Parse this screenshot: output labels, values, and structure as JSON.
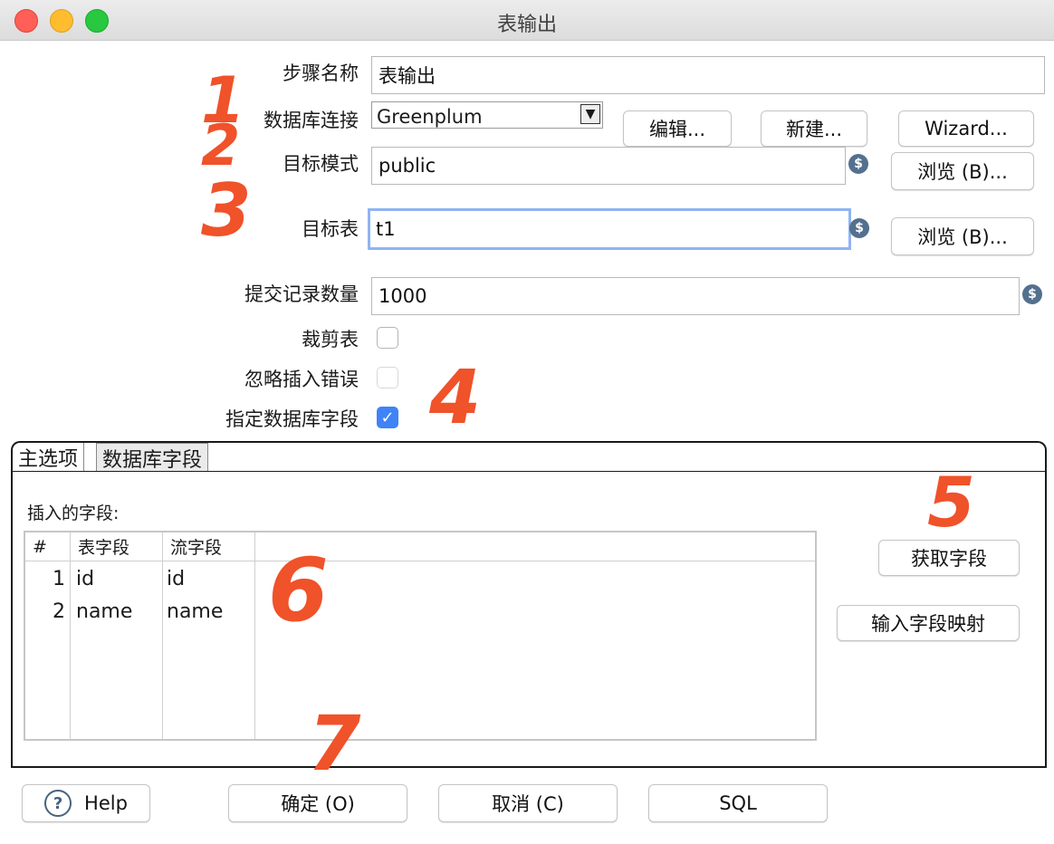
{
  "window": {
    "title": "表输出"
  },
  "form": {
    "step_name": {
      "label": "步骤名称",
      "value": "表输出"
    },
    "db_connection": {
      "label": "数据库连接",
      "value": "Greenplum",
      "edit_label": "编辑...",
      "new_label": "新建...",
      "wizard_label": "Wizard..."
    },
    "target_schema": {
      "label": "目标模式",
      "value": "public",
      "browse_label": "浏览 (B)..."
    },
    "target_table": {
      "label": "目标表",
      "value": "t1",
      "browse_label": "浏览 (B)..."
    },
    "commit_size": {
      "label": "提交记录数量",
      "value": "1000"
    },
    "truncate_table": {
      "label": "裁剪表",
      "checked": false
    },
    "ignore_insert_errors": {
      "label": "忽略插入错误",
      "checked": false
    },
    "specify_db_fields": {
      "label": "指定数据库字段",
      "checked": true,
      "check_glyph": "✓"
    }
  },
  "tabs": [
    {
      "label": "主选项",
      "active": false
    },
    {
      "label": "数据库字段",
      "active": true
    }
  ],
  "fields_tab": {
    "insert_fields_label": "插入的字段:",
    "columns": [
      "#",
      "表字段",
      "流字段"
    ],
    "rows": [
      {
        "num": "1",
        "table_field": "id",
        "stream_field": "id"
      },
      {
        "num": "2",
        "table_field": "name",
        "stream_field": "name"
      }
    ],
    "get_fields_label": "获取字段",
    "input_mapping_label": "输入字段映射"
  },
  "buttons": {
    "help": "Help",
    "ok": "确定 (O)",
    "cancel": "取消 (C)",
    "sql": "SQL"
  },
  "icons": {
    "variable": "$",
    "help": "?",
    "dropdown": "▼"
  },
  "annotations": [
    "1",
    "2",
    "3",
    "4",
    "5",
    "6",
    "7"
  ],
  "colors": {
    "annotation": "#f0522a",
    "checkbox_on": "#3f83f8",
    "focus_ring": "#8fb4f2"
  }
}
